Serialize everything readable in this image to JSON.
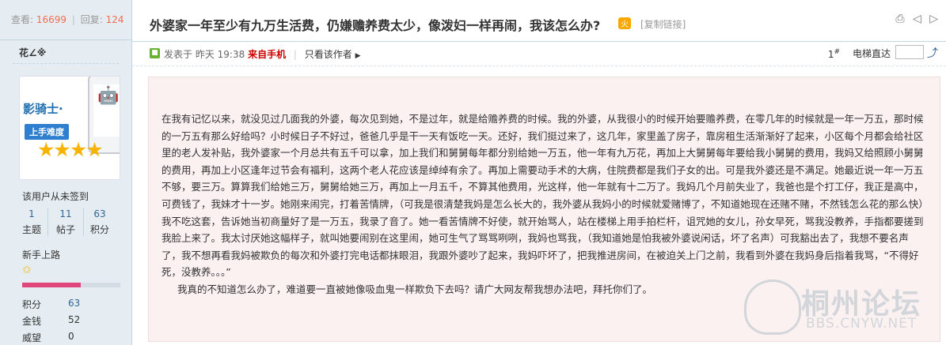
{
  "stats": {
    "views_label": "查看:",
    "views": "16699",
    "sep": "|",
    "replies_label": "回复:",
    "replies": "124"
  },
  "author": {
    "name": "花∠※",
    "signin": "该用户从未签到",
    "counts": [
      {
        "value": "1",
        "label": "主题"
      },
      {
        "value": "11",
        "label": "帖子"
      },
      {
        "value": "63",
        "label": "积分"
      }
    ],
    "rank": "新手上路",
    "rank_progress": 0.6,
    "avatar": {
      "brand": "影骑士·",
      "badge": "上手难度",
      "stars": "★★★★"
    },
    "fields": [
      {
        "label": "积分",
        "value": "63"
      },
      {
        "label": "金钱",
        "value": "52"
      },
      {
        "label": "威望",
        "value": "0"
      }
    ]
  },
  "thread": {
    "title": "外婆家一年至少有九万生活费，仍嫌赡养费太少，像泼妇一样再闹，我该怎么办?",
    "hot_badge": "火",
    "copy_link": "[复制链接]",
    "icons": [
      "print-icon",
      "prev-icon",
      "next-icon"
    ]
  },
  "post": {
    "posted_prefix": "发表于",
    "time": "昨天 19:38",
    "from_mobile": "来自手机",
    "sep": "|",
    "only_author": "只看该作者",
    "floor": "1",
    "floor_sup": "#",
    "elevator": "电梯直达",
    "paragraphs": [
      "在我有记忆以来，就没见过几面我的外婆，每次见到她，不是过年，就是给赡养费的时候。我的外婆，从我很小的时候开始要赡养费，在零几年的时候就是一年一万五，那时候的一万五有那么好给吗？小时候日子不好过，爸爸几乎是干一天有饭吃一天。还好，我们挺过来了，这几年，家里盖了房子，靠房租生活渐渐好了起来，小区每个月都会给社区里的老人发补贴，我外婆家一个月总共有五千可以拿，加上我们和舅舅每年都分别给她一万五，他一年有九万花，再加上大舅舅每年要给我小舅舅的费用，我妈又给照顾小舅舅的费用，再加上小区逢年过节会有福利，这两个老人花应该是绰绰有余了。再加上需要动手术的大病，住院费都是我们子女的出。可是我外婆还是不满足。她最近说一年一万五不够，要三万。算算我们给她三万，舅舅给她三万，再加上一月五千，不算其他费用，光这样，他一年就有十二万了。我妈几个月前失业了，我爸也是个打工仔，我正是高中，可费钱了，我妹才十一岁。她刚来闹完，打着苦情牌，（可我是很清楚我妈是怎么长大的，我外婆从我妈小的时候就爱赌博了，不知道她现在还赌不赌，不然钱怎么花的那么快）我不吃这套，告诉她当初商量好了是一万五，我录了音了。她一看苦情牌不好使，就开始骂人，站在楼梯上用手拍栏杆，诅咒她的女儿，孙女早死，骂我没教养，手指都要搓到我脸上来了。我太讨厌她这幅样子，就叫她要闹别在这里闹，她可生气了骂骂咧咧，我妈也骂我，（我知道她是怕我被外婆说闲话，坏了名声）可我豁出去了，我想不要名声了，我不想再看我妈被欺负的每次和外婆打完电话都抹眼泪，我跟外婆吵了起来，我妈吓坏了，把我推进房间，在被迫关上门之前，我看到外婆在我妈身后指着我骂，“不得好死，没教养。。。”",
      "我真的不知道怎么办了，难道要一直被她像吸血鬼一样欺负下去吗？请广大网友帮我想办法吧，拜托你们了。"
    ]
  },
  "watermark": {
    "cn": "桐州论坛",
    "url": "BBS.CNYW.NET"
  }
}
